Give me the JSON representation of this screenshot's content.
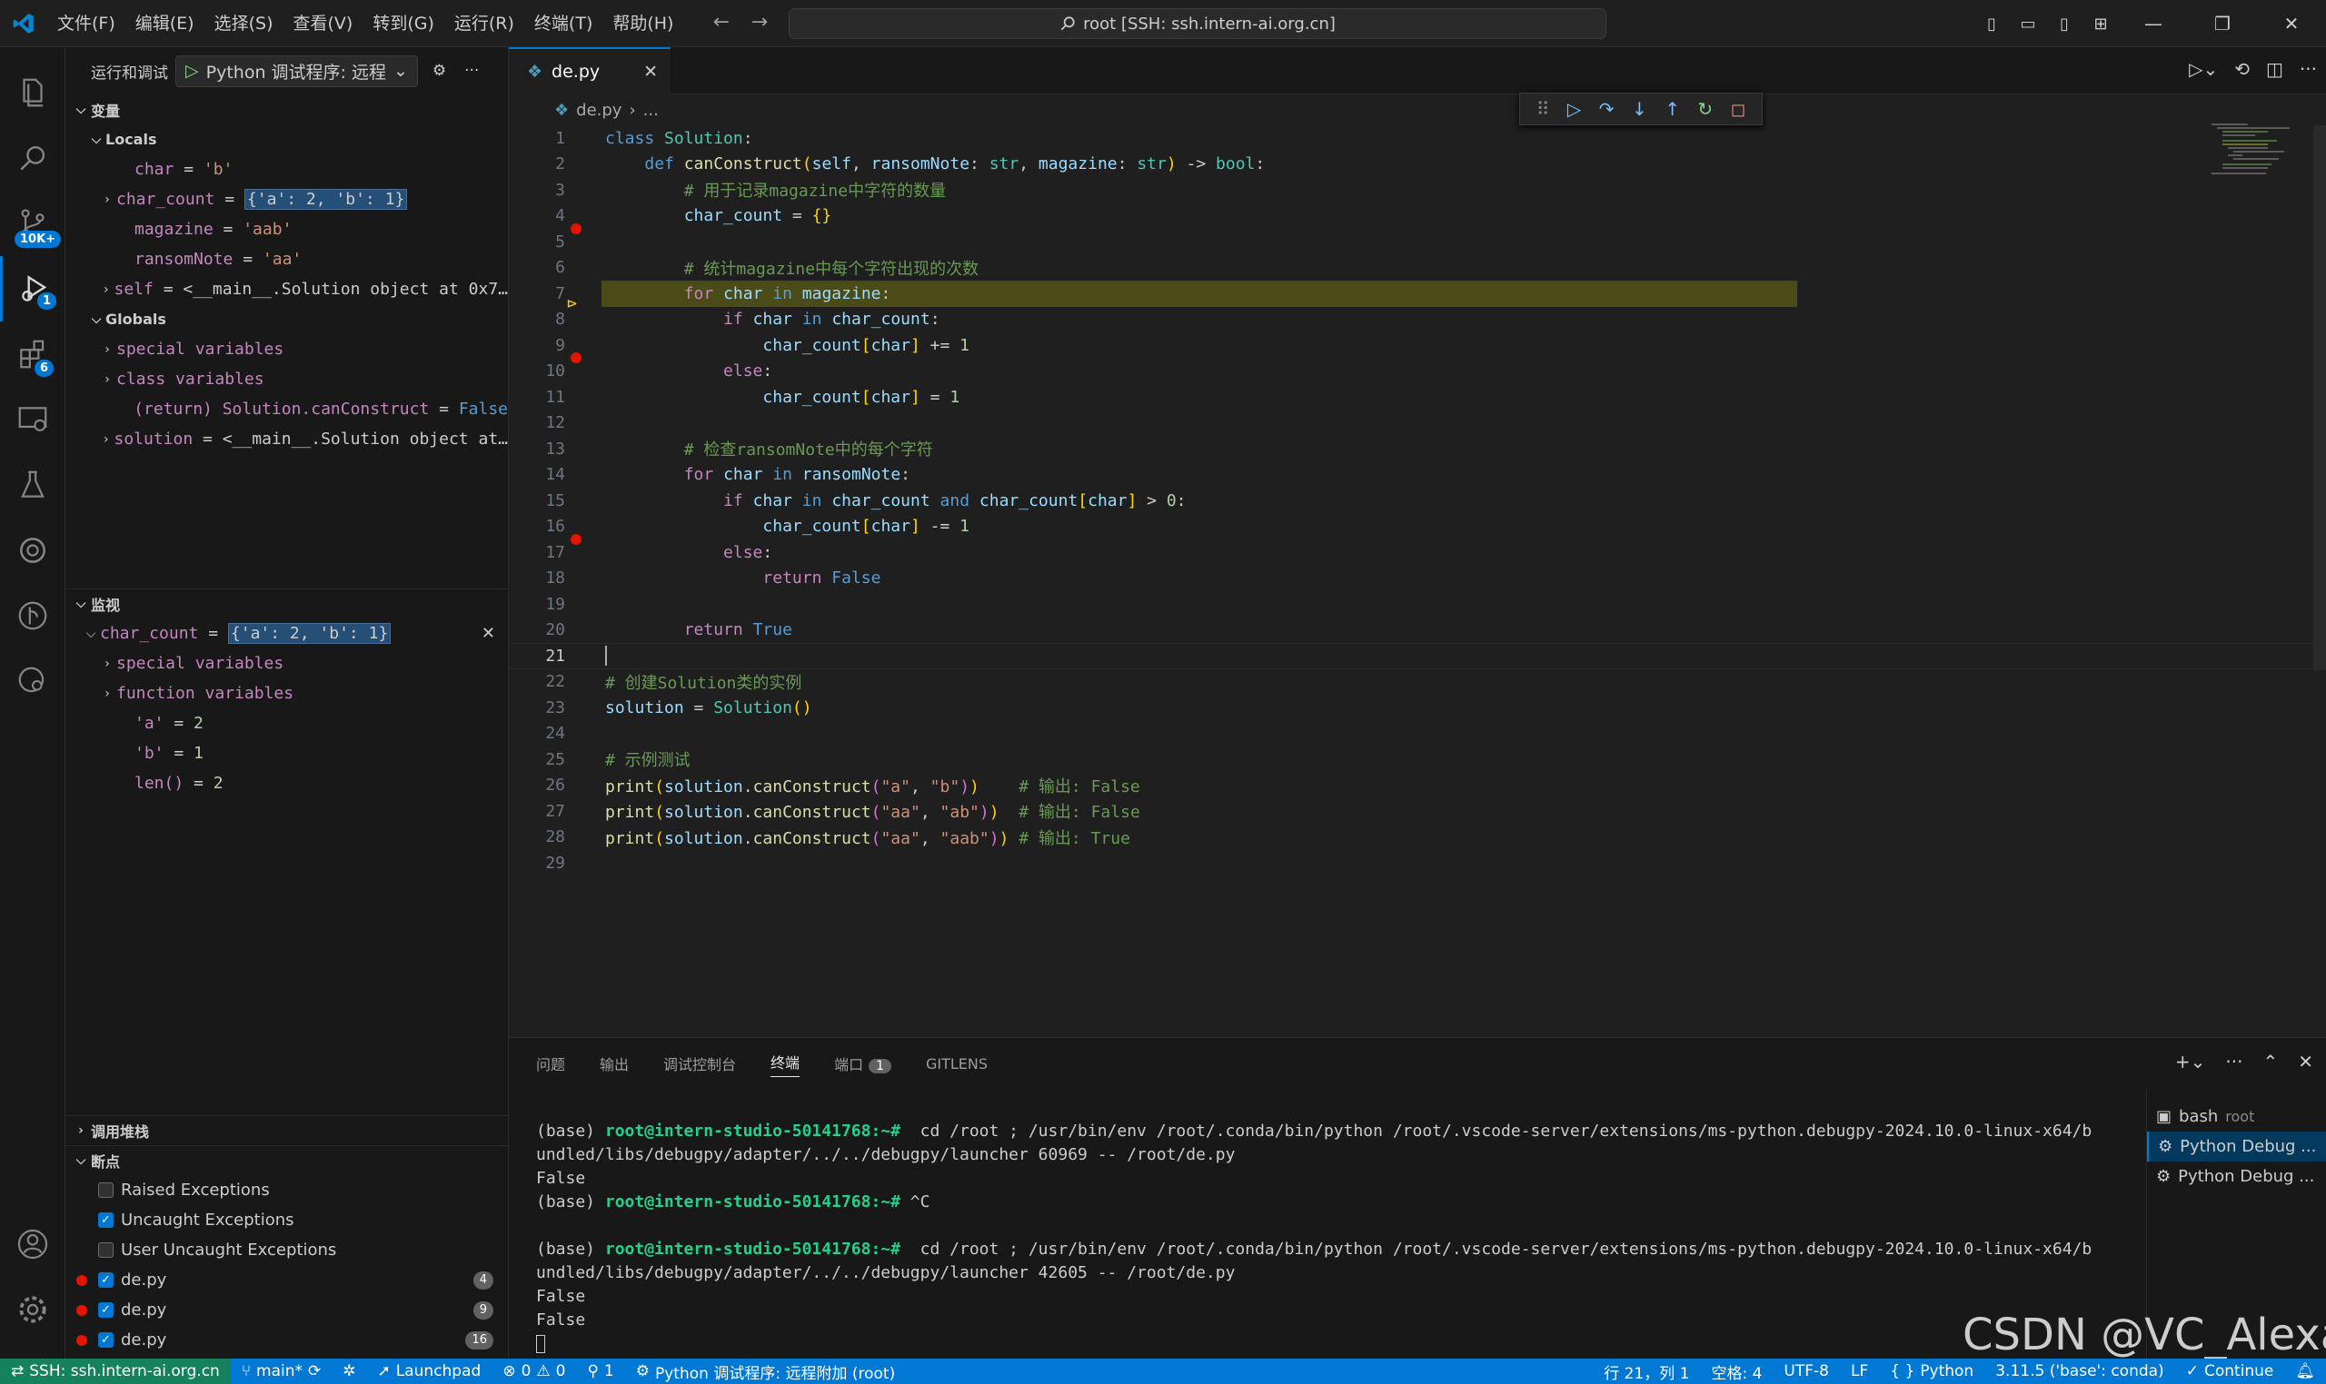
{
  "menu": [
    "文件(F)",
    "编辑(E)",
    "选择(S)",
    "查看(V)",
    "转到(G)",
    "运行(R)",
    "终端(T)",
    "帮助(H)"
  ],
  "command_center": "root [SSH: ssh.intern-ai.org.cn]",
  "activity": {
    "source_control_badge": "10K+",
    "run_debug_badge": "1",
    "extensions_badge": "6"
  },
  "sidebar": {
    "title": "运行和调试",
    "config": "Python 调试程序: 远程",
    "variables_title": "变量",
    "locals_title": "Locals",
    "locals": [
      {
        "name": "char",
        "value": "'b'"
      },
      {
        "name": "char_count",
        "value": "{'a': 2, 'b': 1}"
      },
      {
        "name": "magazine",
        "value": "'aab'"
      },
      {
        "name": "ransomNote",
        "value": "'aa'"
      },
      {
        "name": "self",
        "value": "<__main__.Solution object at 0x7…"
      }
    ],
    "globals_title": "Globals",
    "globals": [
      {
        "label": "special variables"
      },
      {
        "label": "class variables"
      },
      {
        "name": "(return) Solution.canConstruct",
        "value": "False"
      },
      {
        "name": "solution",
        "value": "<__main__.Solution object at…"
      }
    ],
    "watch_title": "监视",
    "watch_expr": "char_count",
    "watch_value": "{'a': 2, 'b': 1}",
    "watch_children": [
      {
        "label": "special variables"
      },
      {
        "label": "function variables"
      },
      {
        "name": "'a'",
        "value": "2"
      },
      {
        "name": "'b'",
        "value": "1"
      },
      {
        "name": "len()",
        "value": "2"
      }
    ],
    "callstack_title": "调用堆栈",
    "breakpoints_title": "断点",
    "breakpoints": [
      {
        "label": "Raised Exceptions",
        "checked": false
      },
      {
        "label": "Uncaught Exceptions",
        "checked": true
      },
      {
        "label": "User Uncaught Exceptions",
        "checked": false
      },
      {
        "label": "de.py",
        "checked": true,
        "line": "4"
      },
      {
        "label": "de.py",
        "checked": true,
        "line": "9"
      },
      {
        "label": "de.py",
        "checked": true,
        "line": "16"
      }
    ]
  },
  "editor": {
    "tab": "de.py",
    "breadcrumb_file": "de.py",
    "breadcrumb_rest": "...",
    "current_line": 21,
    "highlight_line": 7,
    "breakpoint_lines": [
      4,
      9,
      16
    ]
  },
  "panel": {
    "tabs": [
      "问题",
      "输出",
      "调试控制台",
      "终端",
      "端口",
      "GITLENS"
    ],
    "ports_count": "1",
    "terminal_lines": [
      "(base) @@root@intern-studio-50141768:~#@@  cd /root ; /usr/bin/env /root/.conda/bin/python /root/.vscode-server/extensions/ms-python.debugpy-2024.10.0-linux-x64/b",
      "undled/libs/debugpy/adapter/../../debugpy/launcher 60969 -- /root/de.py",
      "False",
      "(base) @@root@intern-studio-50141768:~#@@ ^C",
      "",
      "(base) @@root@intern-studio-50141768:~#@@  cd /root ; /usr/bin/env /root/.conda/bin/python /root/.vscode-server/extensions/ms-python.debugpy-2024.10.0-linux-x64/b",
      "undled/libs/debugpy/adapter/../../debugpy/launcher 42605 -- /root/de.py",
      "False",
      "False"
    ],
    "terminals": [
      {
        "name": "bash",
        "sub": "root"
      },
      {
        "name": "Python Debug ...",
        "sub": ""
      },
      {
        "name": "Python Debug ...",
        "sub": ""
      }
    ]
  },
  "status": {
    "remote": "SSH: ssh.intern-ai.org.cn",
    "branch": "main*",
    "launchpad": "Launchpad",
    "errors": "0",
    "warnings": "0",
    "ports": "1",
    "debug": "Python 调试程序: 远程附加 (root)",
    "position": "行 21，列 1",
    "spaces": "空格: 4",
    "encoding": "UTF-8",
    "eol": "LF",
    "language": "Python",
    "interpreter": "3.11.5 ('base': conda)",
    "continue": "Continue"
  },
  "watermark": "CSDN @VC_Alexa"
}
